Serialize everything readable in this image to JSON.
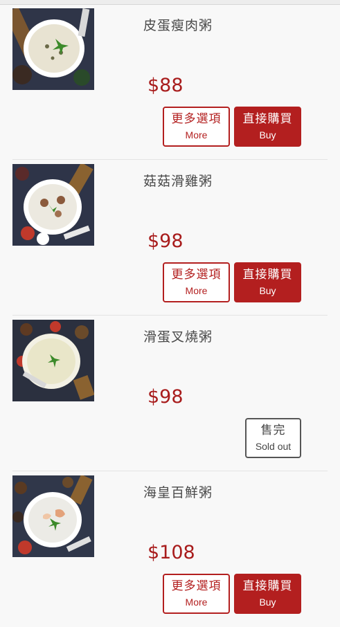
{
  "menu": {
    "items": [
      {
        "name": "皮蛋瘦肉粥",
        "price": "$88",
        "more_zh": "更多選項",
        "more_en": "More",
        "buy_zh": "直接購買",
        "buy_en": "Buy",
        "available": true
      },
      {
        "name": "菇菇滑雞粥",
        "price": "$98",
        "more_zh": "更多選項",
        "more_en": "More",
        "buy_zh": "直接購買",
        "buy_en": "Buy",
        "available": true
      },
      {
        "name": "滑蛋叉燒粥",
        "price": "$98",
        "soldout_zh": "售完",
        "soldout_en": "Sold out",
        "available": false
      },
      {
        "name": "海皇百鮮粥",
        "price": "$108",
        "more_zh": "更多選項",
        "more_en": "More",
        "buy_zh": "直接購買",
        "buy_en": "Buy",
        "available": true
      }
    ]
  },
  "colors": {
    "accent": "#b31f1f",
    "price": "#a81c1c",
    "soldout_border": "#555555",
    "background": "#f8f8f8"
  }
}
